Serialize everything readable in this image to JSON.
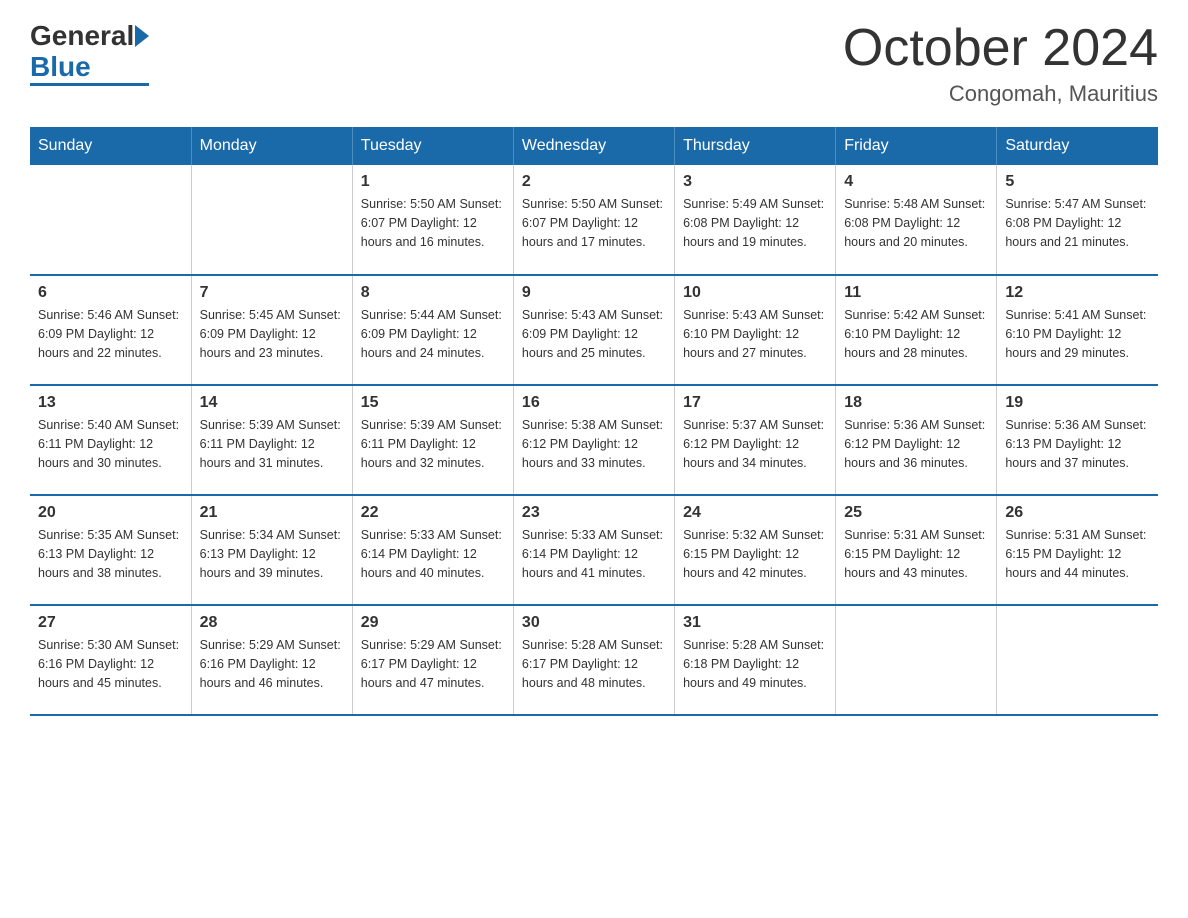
{
  "header": {
    "logo_general": "General",
    "logo_blue": "Blue",
    "month_title": "October 2024",
    "location": "Congomah, Mauritius"
  },
  "columns": [
    "Sunday",
    "Monday",
    "Tuesday",
    "Wednesday",
    "Thursday",
    "Friday",
    "Saturday"
  ],
  "weeks": [
    [
      {
        "day": "",
        "detail": ""
      },
      {
        "day": "",
        "detail": ""
      },
      {
        "day": "1",
        "detail": "Sunrise: 5:50 AM\nSunset: 6:07 PM\nDaylight: 12 hours\nand 16 minutes."
      },
      {
        "day": "2",
        "detail": "Sunrise: 5:50 AM\nSunset: 6:07 PM\nDaylight: 12 hours\nand 17 minutes."
      },
      {
        "day": "3",
        "detail": "Sunrise: 5:49 AM\nSunset: 6:08 PM\nDaylight: 12 hours\nand 19 minutes."
      },
      {
        "day": "4",
        "detail": "Sunrise: 5:48 AM\nSunset: 6:08 PM\nDaylight: 12 hours\nand 20 minutes."
      },
      {
        "day": "5",
        "detail": "Sunrise: 5:47 AM\nSunset: 6:08 PM\nDaylight: 12 hours\nand 21 minutes."
      }
    ],
    [
      {
        "day": "6",
        "detail": "Sunrise: 5:46 AM\nSunset: 6:09 PM\nDaylight: 12 hours\nand 22 minutes."
      },
      {
        "day": "7",
        "detail": "Sunrise: 5:45 AM\nSunset: 6:09 PM\nDaylight: 12 hours\nand 23 minutes."
      },
      {
        "day": "8",
        "detail": "Sunrise: 5:44 AM\nSunset: 6:09 PM\nDaylight: 12 hours\nand 24 minutes."
      },
      {
        "day": "9",
        "detail": "Sunrise: 5:43 AM\nSunset: 6:09 PM\nDaylight: 12 hours\nand 25 minutes."
      },
      {
        "day": "10",
        "detail": "Sunrise: 5:43 AM\nSunset: 6:10 PM\nDaylight: 12 hours\nand 27 minutes."
      },
      {
        "day": "11",
        "detail": "Sunrise: 5:42 AM\nSunset: 6:10 PM\nDaylight: 12 hours\nand 28 minutes."
      },
      {
        "day": "12",
        "detail": "Sunrise: 5:41 AM\nSunset: 6:10 PM\nDaylight: 12 hours\nand 29 minutes."
      }
    ],
    [
      {
        "day": "13",
        "detail": "Sunrise: 5:40 AM\nSunset: 6:11 PM\nDaylight: 12 hours\nand 30 minutes."
      },
      {
        "day": "14",
        "detail": "Sunrise: 5:39 AM\nSunset: 6:11 PM\nDaylight: 12 hours\nand 31 minutes."
      },
      {
        "day": "15",
        "detail": "Sunrise: 5:39 AM\nSunset: 6:11 PM\nDaylight: 12 hours\nand 32 minutes."
      },
      {
        "day": "16",
        "detail": "Sunrise: 5:38 AM\nSunset: 6:12 PM\nDaylight: 12 hours\nand 33 minutes."
      },
      {
        "day": "17",
        "detail": "Sunrise: 5:37 AM\nSunset: 6:12 PM\nDaylight: 12 hours\nand 34 minutes."
      },
      {
        "day": "18",
        "detail": "Sunrise: 5:36 AM\nSunset: 6:12 PM\nDaylight: 12 hours\nand 36 minutes."
      },
      {
        "day": "19",
        "detail": "Sunrise: 5:36 AM\nSunset: 6:13 PM\nDaylight: 12 hours\nand 37 minutes."
      }
    ],
    [
      {
        "day": "20",
        "detail": "Sunrise: 5:35 AM\nSunset: 6:13 PM\nDaylight: 12 hours\nand 38 minutes."
      },
      {
        "day": "21",
        "detail": "Sunrise: 5:34 AM\nSunset: 6:13 PM\nDaylight: 12 hours\nand 39 minutes."
      },
      {
        "day": "22",
        "detail": "Sunrise: 5:33 AM\nSunset: 6:14 PM\nDaylight: 12 hours\nand 40 minutes."
      },
      {
        "day": "23",
        "detail": "Sunrise: 5:33 AM\nSunset: 6:14 PM\nDaylight: 12 hours\nand 41 minutes."
      },
      {
        "day": "24",
        "detail": "Sunrise: 5:32 AM\nSunset: 6:15 PM\nDaylight: 12 hours\nand 42 minutes."
      },
      {
        "day": "25",
        "detail": "Sunrise: 5:31 AM\nSunset: 6:15 PM\nDaylight: 12 hours\nand 43 minutes."
      },
      {
        "day": "26",
        "detail": "Sunrise: 5:31 AM\nSunset: 6:15 PM\nDaylight: 12 hours\nand 44 minutes."
      }
    ],
    [
      {
        "day": "27",
        "detail": "Sunrise: 5:30 AM\nSunset: 6:16 PM\nDaylight: 12 hours\nand 45 minutes."
      },
      {
        "day": "28",
        "detail": "Sunrise: 5:29 AM\nSunset: 6:16 PM\nDaylight: 12 hours\nand 46 minutes."
      },
      {
        "day": "29",
        "detail": "Sunrise: 5:29 AM\nSunset: 6:17 PM\nDaylight: 12 hours\nand 47 minutes."
      },
      {
        "day": "30",
        "detail": "Sunrise: 5:28 AM\nSunset: 6:17 PM\nDaylight: 12 hours\nand 48 minutes."
      },
      {
        "day": "31",
        "detail": "Sunrise: 5:28 AM\nSunset: 6:18 PM\nDaylight: 12 hours\nand 49 minutes."
      },
      {
        "day": "",
        "detail": ""
      },
      {
        "day": "",
        "detail": ""
      }
    ]
  ]
}
